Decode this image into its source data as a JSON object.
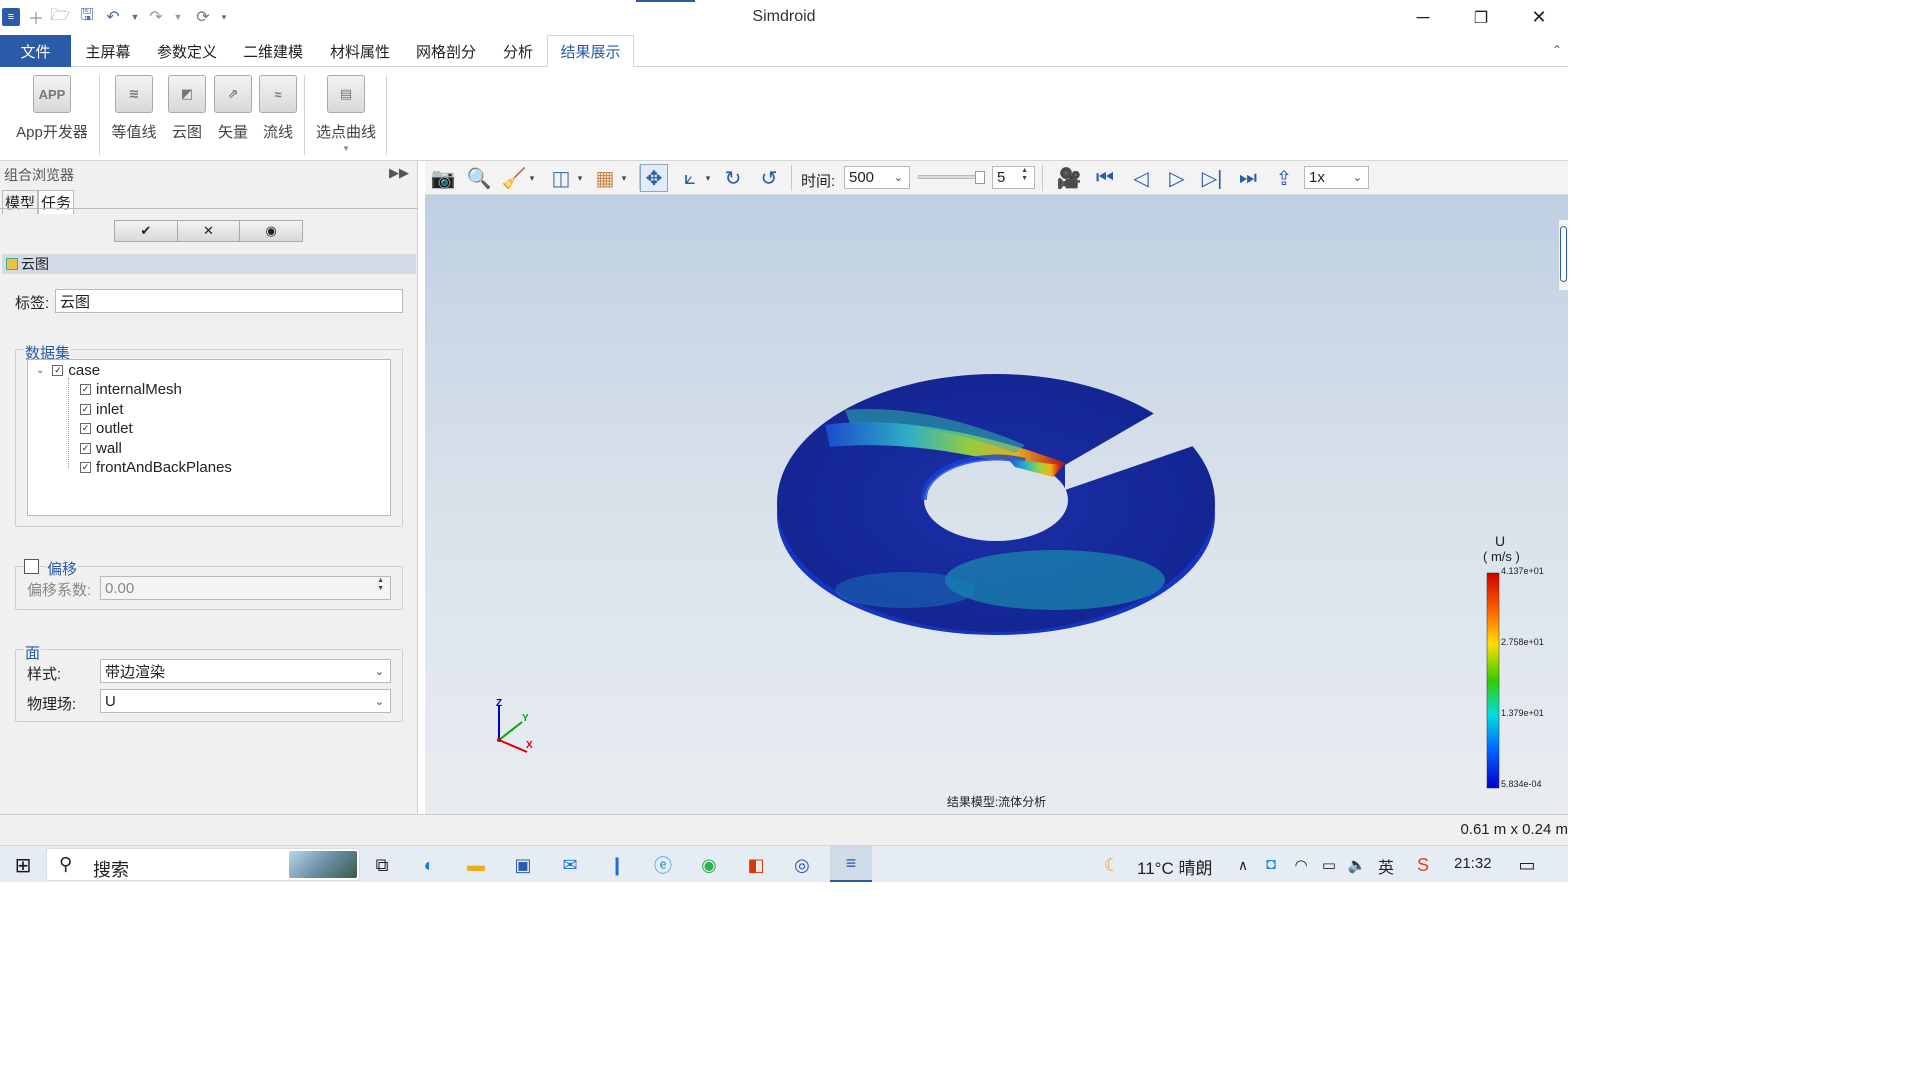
{
  "app": {
    "title": "Simdroid"
  },
  "window_controls": {
    "minimize": "─",
    "restore": "❐",
    "close": "✕"
  },
  "ribbon_tabs": [
    "文件",
    "主屏幕",
    "参数定义",
    "二维建模",
    "材料属性",
    "网格剖分",
    "分析",
    "结果展示"
  ],
  "active_tab": "结果展示",
  "ribbon_buttons": {
    "app_dev": {
      "label": "App开发器",
      "icon_text": "APP"
    },
    "contour": {
      "label": "等值线"
    },
    "cloud": {
      "label": "云图"
    },
    "vector": {
      "label": "矢量"
    },
    "streamline": {
      "label": "流线"
    },
    "probe_curve": {
      "label": "选点曲线"
    }
  },
  "left_panel": {
    "header": "组合浏览器",
    "tabs": [
      "模型",
      "任务"
    ],
    "active_tab": "任务",
    "section_title": "云图",
    "label_field": {
      "label": "标签:",
      "value": "云图"
    },
    "dataset": {
      "title": "数据集",
      "root": "case",
      "children": [
        "internalMesh",
        "inlet",
        "outlet",
        "wall",
        "frontAndBackPlanes"
      ]
    },
    "offset": {
      "title": "偏移",
      "checked": false,
      "coef_label": "偏移系数:",
      "coef_value": "0.00"
    },
    "face": {
      "title": "面",
      "style_label": "样式:",
      "style_value": "带边渲染",
      "field_label": "物理场:",
      "field_value": "U"
    }
  },
  "toolbar": {
    "time_label": "时间:",
    "time_value": "500",
    "step_value": "5",
    "speed_value": "1x"
  },
  "viewport": {
    "model_caption": "结果模型:流体分析",
    "axes": {
      "x": "X",
      "y": "Y",
      "z": "Z"
    },
    "legend": {
      "title": "U",
      "unit": "( m/s )",
      "ticks": [
        "4.137e+01",
        "2.758e+01",
        "1.379e+01",
        "5.834e-04"
      ]
    }
  },
  "statusbar": {
    "dimensions": "0.61 m x 0.24 m"
  },
  "taskbar": {
    "search_label": "搜索",
    "weather": "11°C 晴朗",
    "ime": "英",
    "time": "21:32"
  },
  "colors": {
    "accent": "#2a5aa8",
    "viewport_top": "#bfd0e3",
    "viewport_bottom": "#e9edf1"
  }
}
